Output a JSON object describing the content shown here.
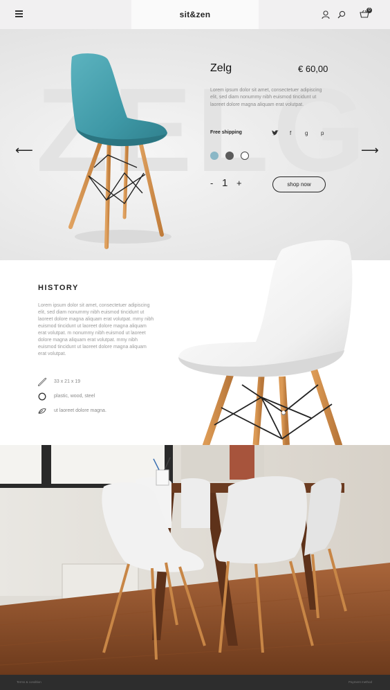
{
  "header": {
    "brand": "sit&zen",
    "cart_count": "0",
    "icons": [
      "menu-icon",
      "user-icon",
      "search-icon",
      "cart-icon"
    ]
  },
  "hero": {
    "bg_text": "ZELG",
    "product_name": "Zelg",
    "price": "€ 60,00",
    "description": "Lorem ipsum dolor sit amet, consectetuer adipiscing elit, sed diam nonummy nibh euismod tincidunt ut laoreet dolore magna aliquam erat volutpat.",
    "shipping": "Free shipping",
    "social_glyphs": [
      "t",
      "f",
      "g",
      "p"
    ],
    "social_icons": [
      "twitter-icon",
      "facebook-icon",
      "google-plus-icon",
      "pinterest-icon"
    ],
    "swatch_colors": [
      "#8ab7c6",
      "#5b5b5b",
      "#ffffff"
    ],
    "quantity_minus": "-",
    "quantity": "1",
    "quantity_plus": "+",
    "shop_button": "shop now",
    "prev_arrow": "⟵",
    "next_arrow": "⟶"
  },
  "history": {
    "title": "HISTORY",
    "text": "Lorem ipsum dolor sit amet, consectetuer adipiscing elit, sed diam nonummy nibh euismod tincidunt ut laoreet dolore magna aliquam erat volutpat. mmy nibh euismod tincidunt ut laoreet dolore magna aliquam erat volutpat. m nonummy nibh euismod ut laoreet dolore magna aliquam erat volutpat. mmy nibh euismod tincidunt ut laoreet dolore magna aliquam erat volutpat.",
    "features": [
      {
        "icon": "ruler-icon",
        "text": "33 x 21 x 19"
      },
      {
        "icon": "circle-icon",
        "text": "plastic, wood, steel"
      },
      {
        "icon": "leaf-icon",
        "text": "ut laoreet dolore magna."
      }
    ]
  },
  "footer": {
    "left": "Terms & condition",
    "right": "Payment method"
  },
  "colors": {
    "chair_teal": "#4aa0ad",
    "wood": "#d9954f",
    "footer_bg": "#2d2d2d"
  }
}
